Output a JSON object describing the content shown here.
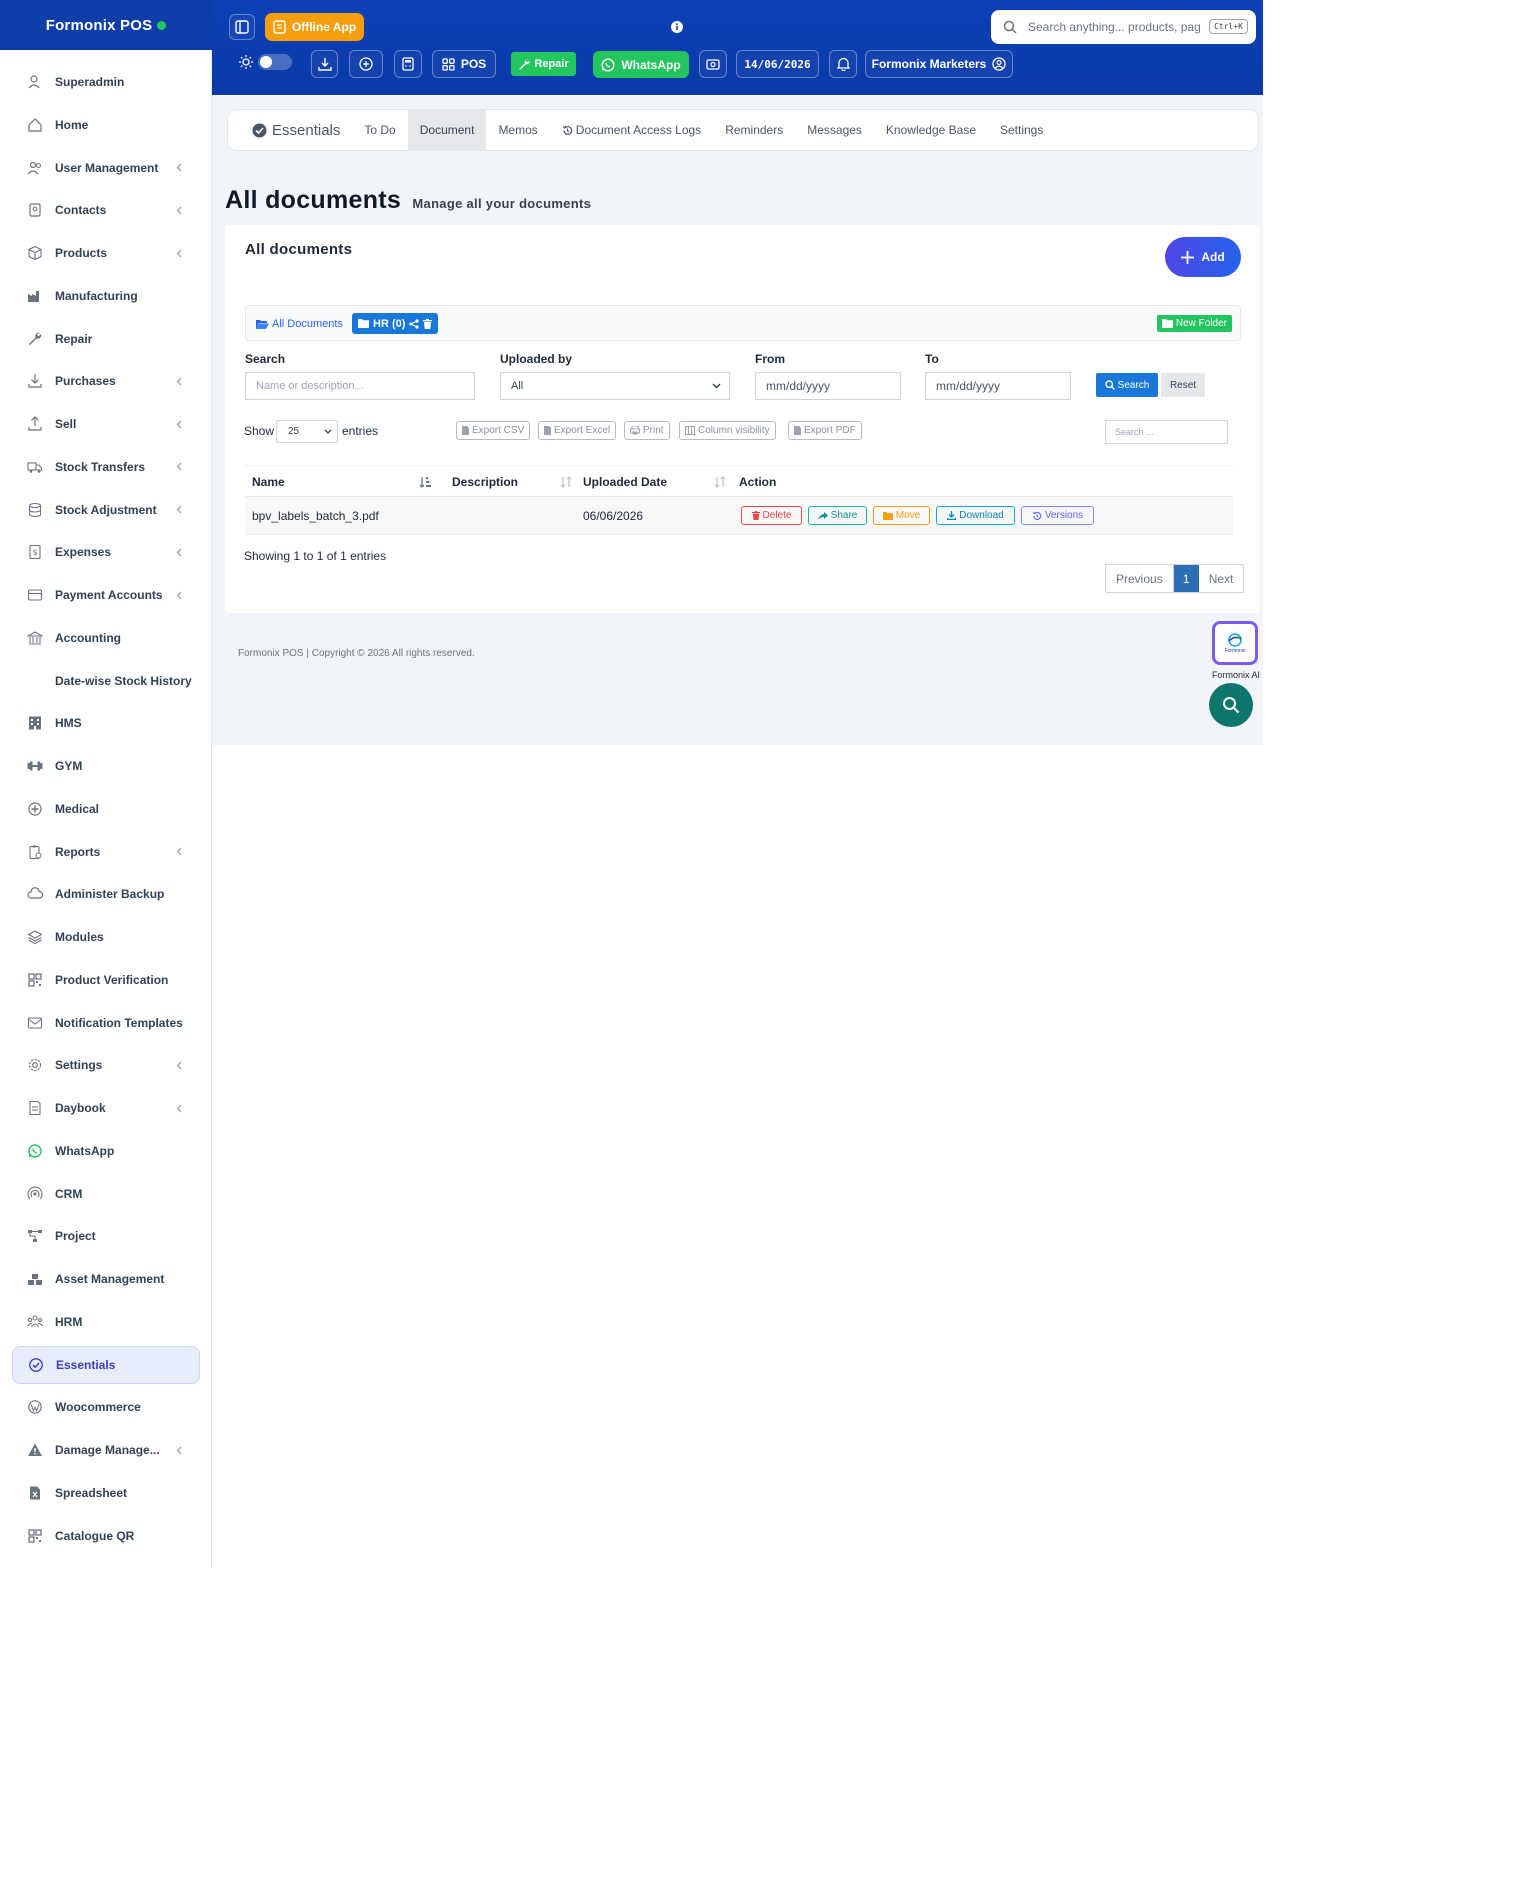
{
  "brand": {
    "name": "Formonix POS"
  },
  "sidebar": {
    "items": [
      {
        "label": "Superadmin",
        "icon": "user-shield-icon",
        "chevron": false,
        "active": false
      },
      {
        "label": "Home",
        "icon": "home-icon",
        "chevron": false,
        "active": false
      },
      {
        "label": "User Management",
        "icon": "users-icon",
        "chevron": true,
        "active": false
      },
      {
        "label": "Contacts",
        "icon": "address-book-icon",
        "chevron": true,
        "active": false
      },
      {
        "label": "Products",
        "icon": "cube-icon",
        "chevron": true,
        "active": false
      },
      {
        "label": "Manufacturing",
        "icon": "factory-icon",
        "chevron": false,
        "active": false
      },
      {
        "label": "Repair",
        "icon": "wrench-icon",
        "chevron": false,
        "active": false
      },
      {
        "label": "Purchases",
        "icon": "arrow-down-tray-icon",
        "chevron": true,
        "active": false
      },
      {
        "label": "Sell",
        "icon": "arrow-up-tray-icon",
        "chevron": true,
        "active": false
      },
      {
        "label": "Stock Transfers",
        "icon": "truck-icon",
        "chevron": true,
        "active": false
      },
      {
        "label": "Stock Adjustment",
        "icon": "database-icon",
        "chevron": true,
        "active": false
      },
      {
        "label": "Expenses",
        "icon": "receipt-icon",
        "chevron": true,
        "active": false
      },
      {
        "label": "Payment Accounts",
        "icon": "credit-card-icon",
        "chevron": true,
        "active": false
      },
      {
        "label": "Accounting",
        "icon": "bank-icon",
        "chevron": false,
        "active": false
      },
      {
        "label": "Date-wise Stock History",
        "icon": "",
        "chevron": false,
        "active": false
      },
      {
        "label": "HMS",
        "icon": "hotel-icon",
        "chevron": false,
        "active": false
      },
      {
        "label": "GYM",
        "icon": "dumbbell-icon",
        "chevron": false,
        "active": false
      },
      {
        "label": "Medical",
        "icon": "medical-icon",
        "chevron": false,
        "active": false
      },
      {
        "label": "Reports",
        "icon": "report-icon",
        "chevron": true,
        "active": false
      },
      {
        "label": "Administer Backup",
        "icon": "cloud-icon",
        "chevron": false,
        "active": false
      },
      {
        "label": "Modules",
        "icon": "layers-icon",
        "chevron": false,
        "active": false
      },
      {
        "label": "Product Verification",
        "icon": "qr-grid-icon",
        "chevron": false,
        "active": false
      },
      {
        "label": "Notification Templates",
        "icon": "envelope-icon",
        "chevron": false,
        "active": false
      },
      {
        "label": "Settings",
        "icon": "gear-icon",
        "chevron": true,
        "active": false
      },
      {
        "label": "Daybook",
        "icon": "book-icon",
        "chevron": true,
        "active": false
      },
      {
        "label": "WhatsApp",
        "icon": "whatsapp-icon",
        "chevron": false,
        "active": false
      },
      {
        "label": "CRM",
        "icon": "broadcast-icon",
        "chevron": false,
        "active": false
      },
      {
        "label": "Project",
        "icon": "project-icon",
        "chevron": false,
        "active": false
      },
      {
        "label": "Asset Management",
        "icon": "boxes-icon",
        "chevron": false,
        "active": false
      },
      {
        "label": "HRM",
        "icon": "people-group-icon",
        "chevron": false,
        "active": false
      },
      {
        "label": "Essentials",
        "icon": "check-circle-icon",
        "chevron": false,
        "active": true
      },
      {
        "label": "Woocommerce",
        "icon": "wordpress-icon",
        "chevron": false,
        "active": false
      },
      {
        "label": "Damage Manage...",
        "icon": "warning-icon",
        "chevron": true,
        "active": false
      },
      {
        "label": "Spreadsheet",
        "icon": "spreadsheet-icon",
        "chevron": false,
        "active": false
      },
      {
        "label": "Catalogue QR",
        "icon": "qr-grid-icon",
        "chevron": false,
        "active": false
      }
    ]
  },
  "topbar": {
    "offline_label": "Offline App",
    "pos_label": "POS",
    "repair_label": "Repair",
    "whatsapp_label": "WhatsApp",
    "date": "14/06/2026",
    "business_name": "Formonix Marketers",
    "search_placeholder": "Search anything... products, pag",
    "search_shortcut": "Ctrl+K"
  },
  "tabs": {
    "brand": "Essentials",
    "items": [
      "To Do",
      "Document",
      "Memos",
      "Document Access Logs",
      "Reminders",
      "Messages",
      "Knowledge Base",
      "Settings"
    ],
    "active": "Document"
  },
  "page": {
    "title": "All documents",
    "subtitle": "Manage all your documents"
  },
  "card": {
    "title": "All documents",
    "add_label": "Add",
    "breadcrumb_all": "All Documents",
    "breadcrumb_folder": "HR (0)",
    "new_folder_label": "New Folder"
  },
  "filters": {
    "search_label": "Search",
    "search_placeholder": "Name or description...",
    "uploaded_by_label": "Uploaded by",
    "uploaded_by_value": "All",
    "from_label": "From",
    "from_placeholder": "mm/dd/yyyy",
    "to_label": "To",
    "to_placeholder": "mm/dd/yyyy",
    "search_button": "Search",
    "reset_button": "Reset"
  },
  "table": {
    "show_label": "Show",
    "page_size": "25",
    "entries_label": "entries",
    "export_buttons": [
      "Export CSV",
      "Export Excel",
      "Print",
      "Column visibility",
      "Export PDF"
    ],
    "search_placeholder": "Search ...",
    "columns": [
      "Name",
      "Description",
      "Uploaded Date",
      "Action"
    ],
    "rows": [
      {
        "name": "bpv_labels_batch_3.pdf",
        "description": "",
        "uploaded_date": "06/06/2026"
      }
    ],
    "actions": [
      "Delete",
      "Share",
      "Move",
      "Download",
      "Versions"
    ],
    "info": "Showing 1 to 1 of 1 entries",
    "pager": {
      "previous": "Previous",
      "current": "1",
      "next": "Next"
    }
  },
  "footer": {
    "text": "Formonix POS | Copyright © 2026 All rights reserved."
  },
  "ai": {
    "label": "Formonix AI",
    "logo_text": "Formonix"
  },
  "colors": {
    "primary": "#0b3aa6",
    "accent": "#4f46e5",
    "success": "#22c55e",
    "warning": "#f59e0b",
    "danger": "#ef4444",
    "info": "#0ea5e9"
  }
}
